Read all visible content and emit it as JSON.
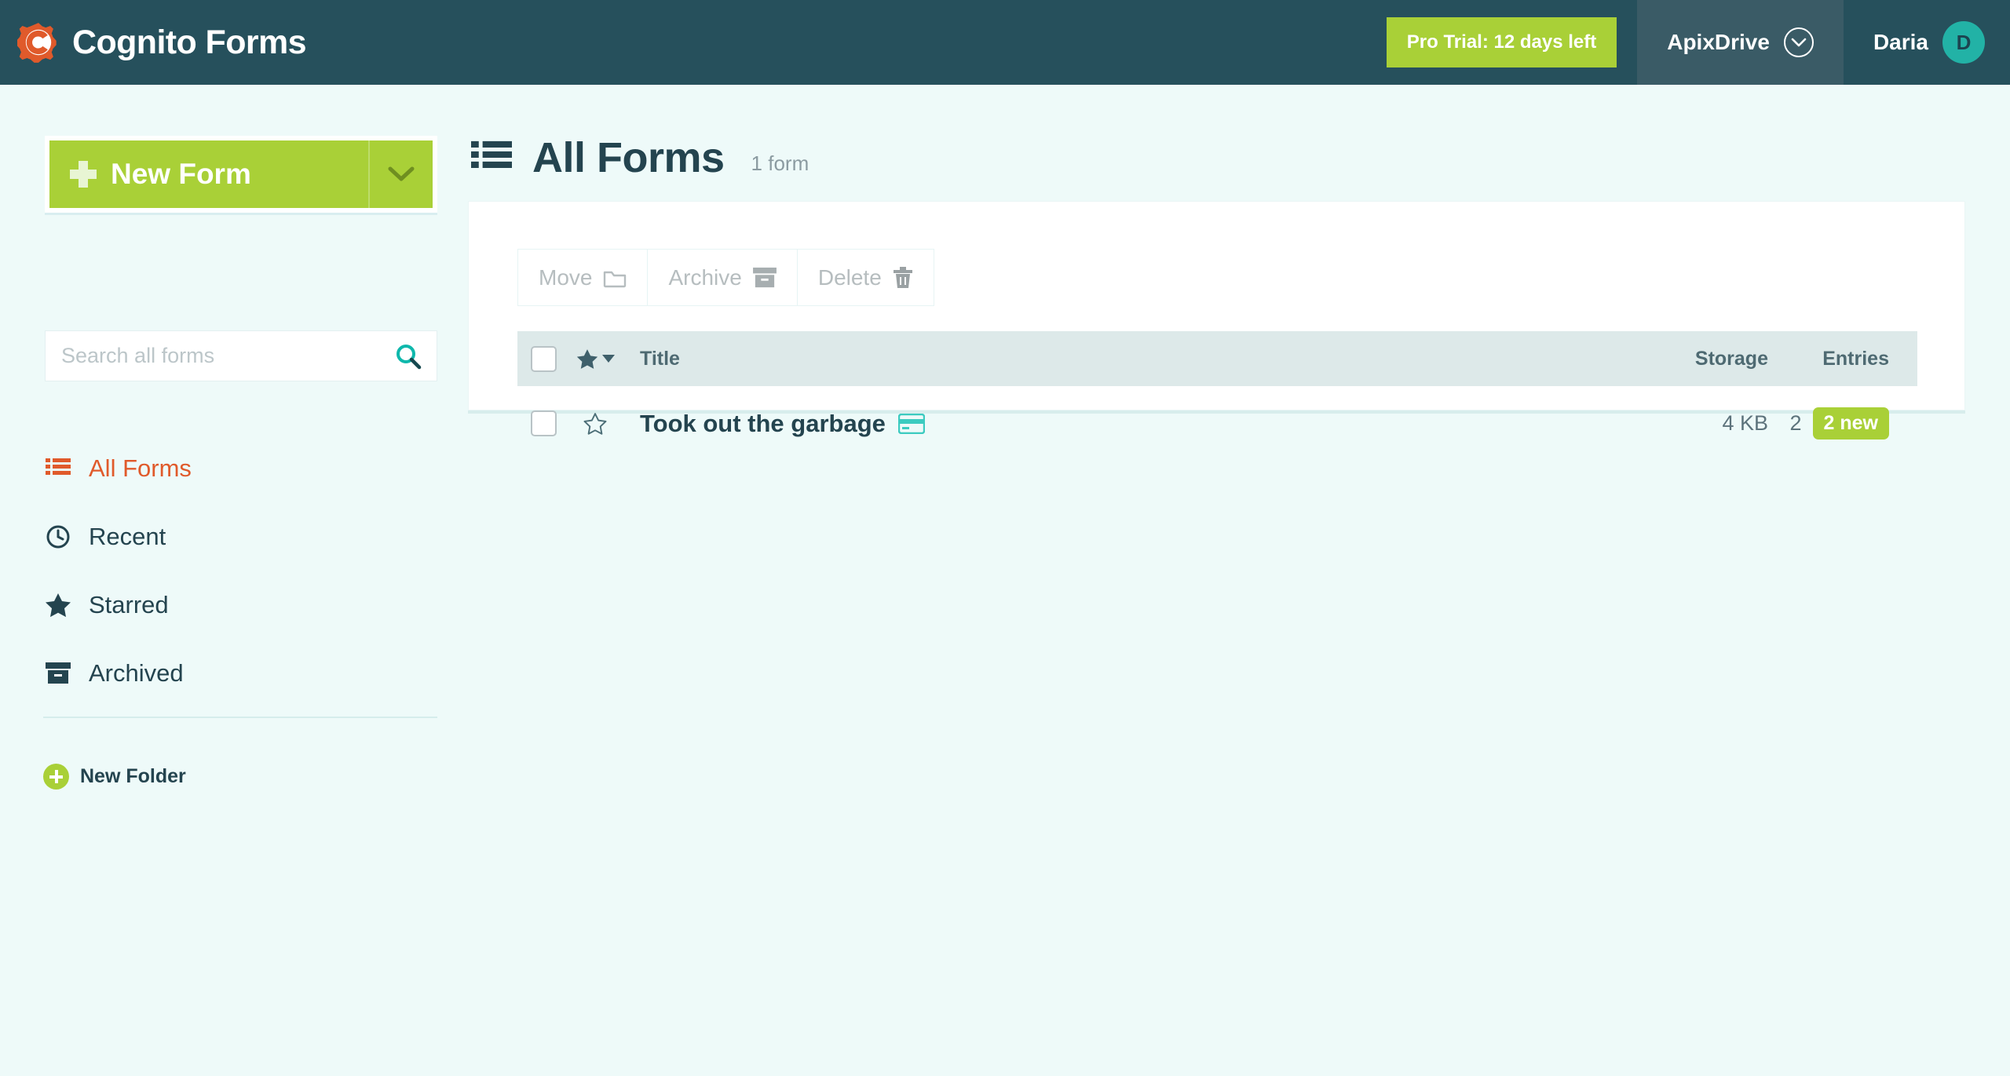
{
  "topbar": {
    "logo_icon": "cognito-gear-icon",
    "brand": "Cognito Forms",
    "trial_badge": "Pro Trial: 12 days left",
    "org_name": "ApixDrive",
    "org_chevron_icon": "chevron-down-circle-icon",
    "user_name": "Daria",
    "avatar_initial": "D"
  },
  "sidebar": {
    "new_form_label": "New Form",
    "new_form_plus_icon": "plus-icon",
    "new_form_dropdown_icon": "chevron-down-icon",
    "search": {
      "value": "",
      "placeholder": "Search all forms",
      "icon": "search-icon"
    },
    "items": [
      {
        "label": "All Forms",
        "icon": "list-icon",
        "active": true
      },
      {
        "label": "Recent",
        "icon": "clock-icon",
        "active": false
      },
      {
        "label": "Starred",
        "icon": "star-filled-icon",
        "active": false
      },
      {
        "label": "Archived",
        "icon": "archive-box-icon",
        "active": false
      }
    ],
    "new_folder_label": "New Folder",
    "new_folder_icon": "plus-circle-icon"
  },
  "main": {
    "page_icon": "list-icon",
    "page_title": "All Forms",
    "page_count": "1 form",
    "toolbar": [
      {
        "label": "Move",
        "icon": "folder-icon",
        "disabled": true
      },
      {
        "label": "Archive",
        "icon": "archive-box-icon",
        "disabled": true
      },
      {
        "label": "Delete",
        "icon": "trash-icon",
        "disabled": true
      }
    ],
    "table": {
      "columns": {
        "title": "Title",
        "storage": "Storage",
        "entries": "Entries"
      },
      "header_star_icon": "star-filled-sort-icon",
      "rows": [
        {
          "title": "Took out the garbage",
          "title_badge_icon": "payment-card-icon",
          "storage": "4 KB",
          "entries": "2",
          "new_badge": "2 new",
          "starred": false,
          "selected": false
        }
      ]
    }
  },
  "colors": {
    "header_bg": "#26505c",
    "org_bg": "#3a5b66",
    "accent_green": "#a9d037",
    "accent_orange": "#e05a2b",
    "accent_teal": "#22b2a6",
    "page_bg": "#eefaf9",
    "table_header_bg": "#dde9e9"
  }
}
